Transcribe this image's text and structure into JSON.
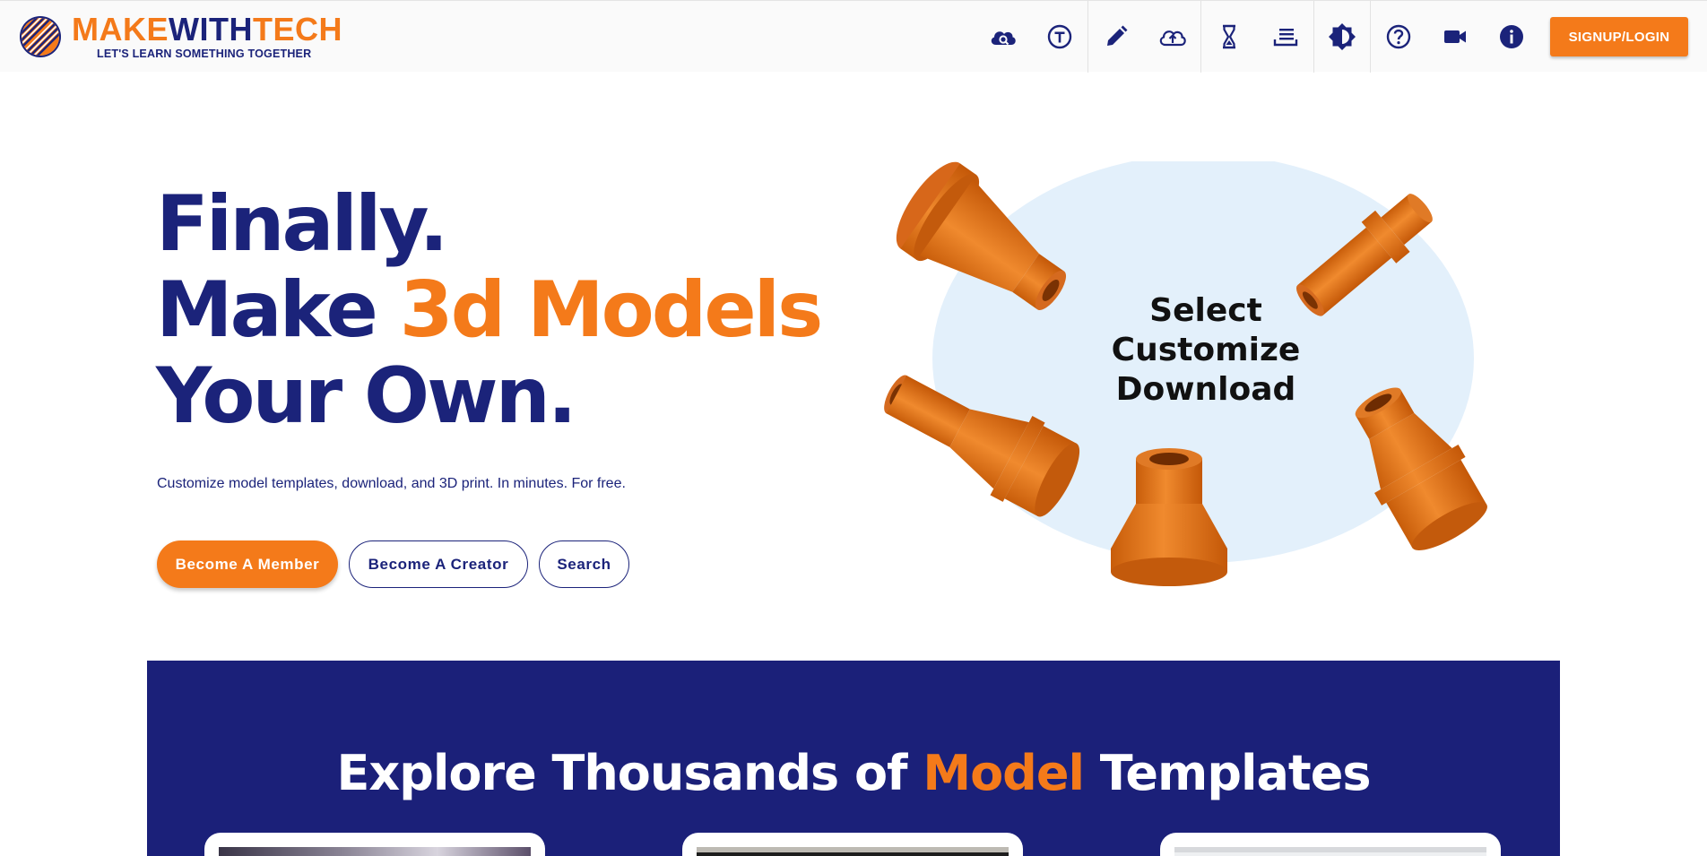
{
  "brand": {
    "name_part1": "MAKE",
    "name_part2": "WITH",
    "name_part3": "TECH",
    "tagline": "LET'S LEARN SOMETHING TOGETHER"
  },
  "toolbar": {
    "icons": [
      "cloud-search-icon",
      "text-t-icon",
      "pencil-icon",
      "cloud-upload-icon",
      "hourglass-icon",
      "list-stack-icon",
      "contrast-icon",
      "help-icon",
      "video-camera-icon",
      "info-icon"
    ],
    "signup_label": "SIGNUP/LOGIN"
  },
  "hero": {
    "line1": "Finally.",
    "line2_prefix": "Make ",
    "line2_accent": "3d Models",
    "line3": "Your Own.",
    "subtitle": "Customize model templates, download, and 3D print. In minutes. For free.",
    "buttons": {
      "member": "Become A Member",
      "creator": "Become A Creator",
      "search": "Search"
    },
    "art_lines": [
      "Select",
      "Customize",
      "Download"
    ]
  },
  "explore": {
    "title_prefix": "Explore Thousands of ",
    "title_accent": "Model",
    "title_suffix": " Templates"
  },
  "colors": {
    "navy": "#1b237a",
    "orange": "#f47a1a",
    "banner": "#1b2079",
    "blob": "#e3f0fb"
  }
}
